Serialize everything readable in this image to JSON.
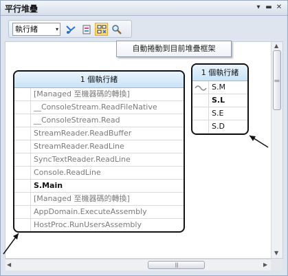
{
  "window": {
    "title": "平行堆疊"
  },
  "window_controls": {
    "dropdown": "▾",
    "pin": "▬",
    "close": "✕"
  },
  "toolbar": {
    "view_combo": {
      "value": "執行緒",
      "arrow": "▾"
    }
  },
  "tooltip": {
    "text": "自動捲動到目前堆疊框架"
  },
  "main_stack": {
    "header": "1 個執行緒",
    "frames": [
      "[Managed 至機器碼的轉換]",
      "__ConsoleStream.ReadFileNative",
      "__ConsoleStream.Read",
      "StreamReader.ReadBuffer",
      "StreamReader.ReadLine",
      "SyncTextReader.ReadLine",
      "Console.ReadLine",
      "S.Main",
      "[Managed 至機器碼的轉換]",
      "AppDomain.ExecuteAssembly",
      "HostProc.RunUsersAssembly"
    ]
  },
  "side_stack": {
    "header": "1 個執行緒",
    "frames": [
      "S.M",
      "S.L",
      "S.E",
      "S.D"
    ]
  },
  "scrollbar": {
    "grip": "|||"
  },
  "colors": {
    "header_top": "#eaf4fc",
    "header_bottom": "#c9e3f6",
    "active_button": "#ffd46a",
    "frame_text_gray": "#7a7a7a"
  }
}
